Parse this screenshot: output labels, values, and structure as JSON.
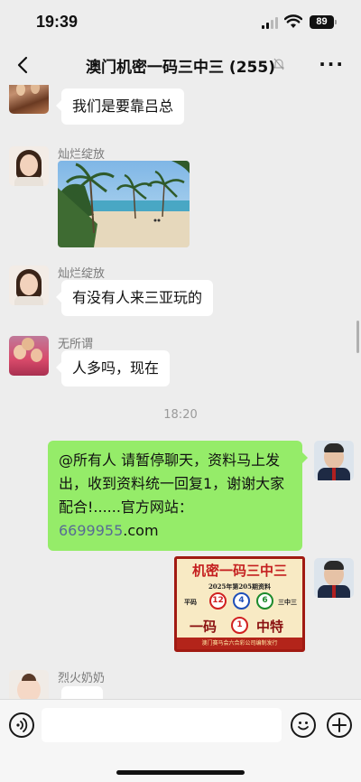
{
  "status": {
    "time": "19:39",
    "battery": "89"
  },
  "nav": {
    "title": "澳门机密一码三中三 (255)"
  },
  "messages": {
    "m1": {
      "sender": "",
      "text": "我们是要靠吕总"
    },
    "m2": {
      "sender": "灿烂绽放"
    },
    "m3": {
      "sender": "灿烂绽放",
      "text": "有没有人来三亚玩的"
    },
    "m4": {
      "sender": "无所谓",
      "text": "人多吗，现在"
    },
    "time": "18:20",
    "m5": {
      "text_before": "@所有人 请暂停聊天，资料马上发出，收到资料统一回复1，谢谢大家配合!......官方网站：",
      "link": "6699955",
      "text_after": ".com"
    },
    "m7": {
      "sender": "烈火奶奶"
    }
  },
  "poster": {
    "title": "机密一码三中三",
    "subtitle": "2025年第205期资料",
    "label_left": "平码",
    "label_right": "三中三",
    "balls": [
      "12",
      "4",
      "6"
    ],
    "special_left": "一码",
    "special_ball": "1",
    "special_right": "中特",
    "footer": "澳门赛马会六合彩公司编制发行"
  },
  "colors": {
    "bubble_self": "#95ec69",
    "link": "#576b95",
    "background": "#ededed"
  }
}
